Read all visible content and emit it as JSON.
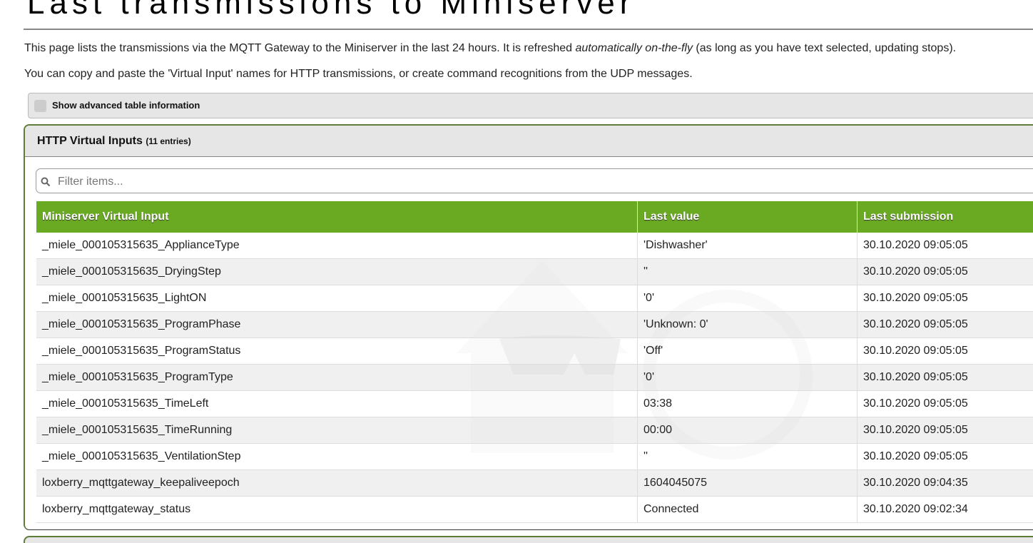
{
  "page": {
    "title": "Last transmissions to Miniserver",
    "intro_1_pre": "This page lists the transmissions via the MQTT Gateway to the Miniserver in the last 24 hours. It is refreshed ",
    "intro_1_em": "automatically on-the-fly",
    "intro_1_post": " (as long as you have text selected, updating stops).",
    "intro_2": "You can copy and paste the 'Virtual Input' names for HTTP transmissions, or create command recognitions from the UDP messages."
  },
  "advanced": {
    "label": "Show advanced table information",
    "checked": false
  },
  "panel": {
    "title": "HTTP Virtual Inputs",
    "count": "(11 entries)",
    "filter_placeholder": "Filter items...",
    "columns": [
      "Miniserver Virtual Input",
      "Last value",
      "Last submission"
    ],
    "rows": [
      [
        "_miele_000105315635_ApplianceType",
        "'Dishwasher'",
        "30.10.2020 09:05:05"
      ],
      [
        "_miele_000105315635_DryingStep",
        "''",
        "30.10.2020 09:05:05"
      ],
      [
        "_miele_000105315635_LightON",
        "'0'",
        "30.10.2020 09:05:05"
      ],
      [
        "_miele_000105315635_ProgramPhase",
        "'Unknown: 0'",
        "30.10.2020 09:05:05"
      ],
      [
        "_miele_000105315635_ProgramStatus",
        "'Off'",
        "30.10.2020 09:05:05"
      ],
      [
        "_miele_000105315635_ProgramType",
        "'0'",
        "30.10.2020 09:05:05"
      ],
      [
        "_miele_000105315635_TimeLeft",
        "03:38",
        "30.10.2020 09:05:05"
      ],
      [
        "_miele_000105315635_TimeRunning",
        "00:00",
        "30.10.2020 09:05:05"
      ],
      [
        "_miele_000105315635_VentilationStep",
        "''",
        "30.10.2020 09:05:05"
      ],
      [
        "loxberry_mqttgateway_keepaliveepoch",
        "1604045075",
        "30.10.2020 09:04:35"
      ],
      [
        "loxberry_mqttgateway_status",
        "Connected",
        "30.10.2020 09:02:34"
      ]
    ]
  },
  "colors": {
    "header_green": "#6aaa22",
    "panel_border": "#5e7d3a"
  }
}
